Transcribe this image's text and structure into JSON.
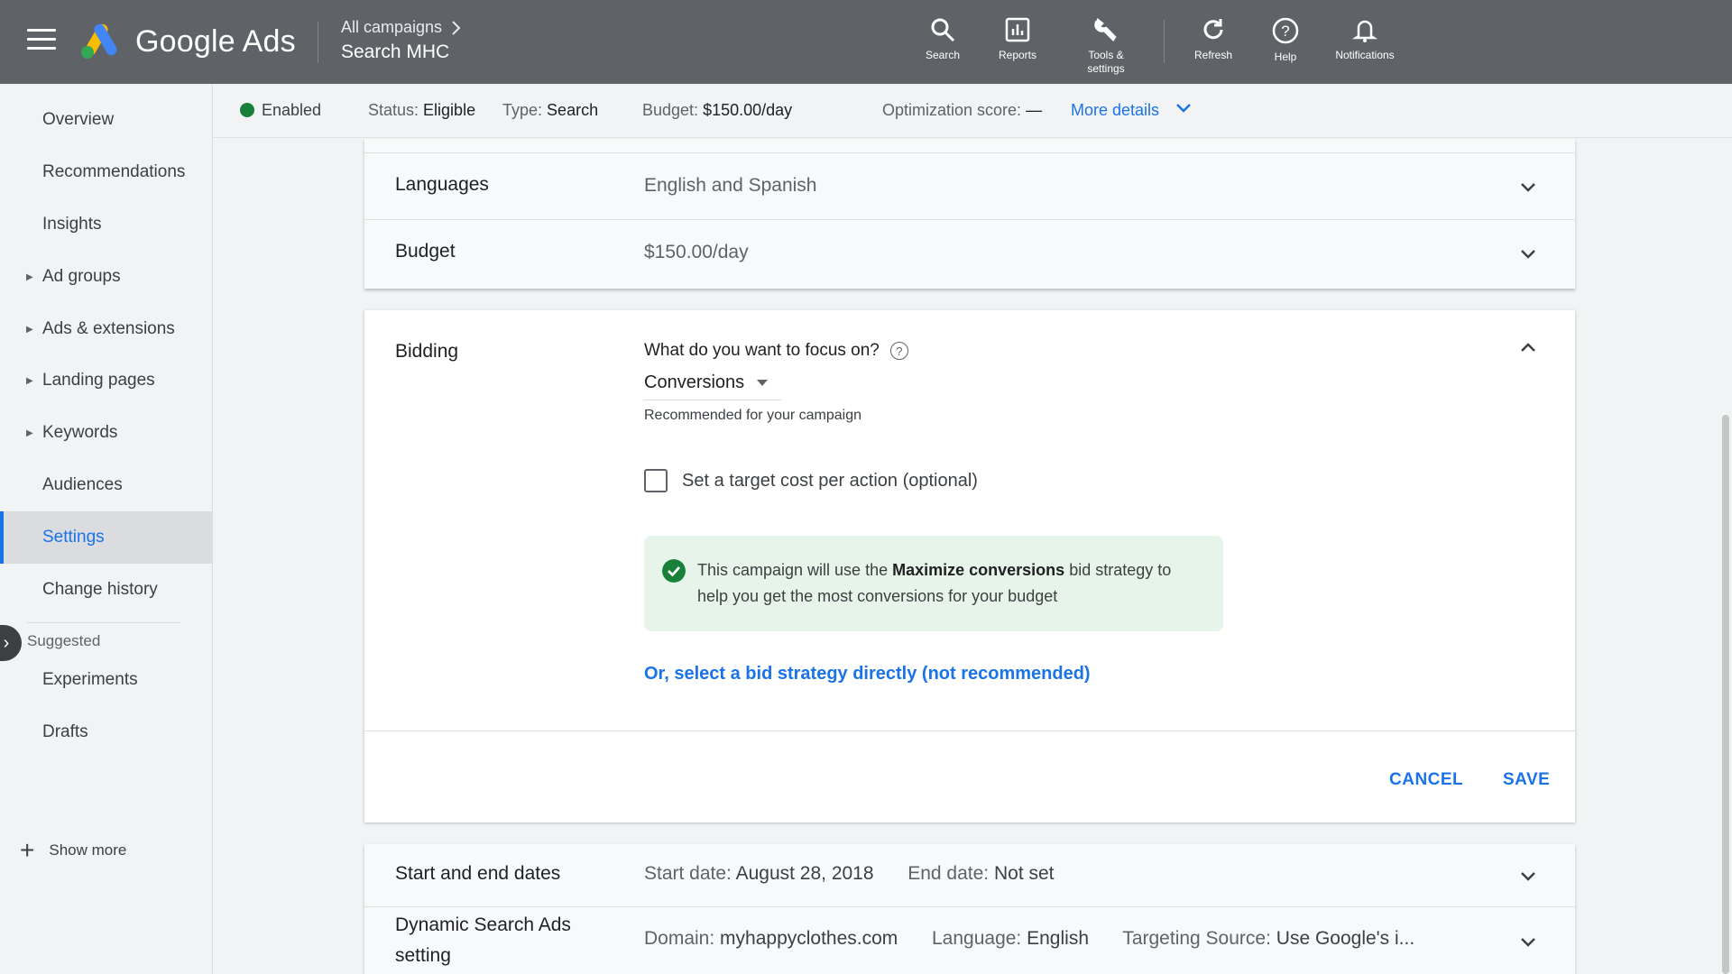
{
  "header": {
    "brand": "Google Ads",
    "breadcrumb": "All campaigns",
    "campaign_name": "Search MHC",
    "tools": [
      {
        "label": "Search",
        "icon": "search-icon"
      },
      {
        "label": "Reports",
        "icon": "reports-icon"
      },
      {
        "label": "Tools &\nsettings",
        "icon": "wrench-icon"
      },
      {
        "label": "Refresh",
        "icon": "refresh-icon"
      },
      {
        "label": "Help",
        "icon": "help-icon"
      },
      {
        "label": "Notifications",
        "icon": "bell-icon"
      }
    ]
  },
  "sidebar": {
    "items": [
      {
        "label": "Overview"
      },
      {
        "label": "Recommendations"
      },
      {
        "label": "Insights"
      },
      {
        "label": "Ad groups"
      },
      {
        "label": "Ads & extensions"
      },
      {
        "label": "Landing pages"
      },
      {
        "label": "Keywords"
      },
      {
        "label": "Audiences"
      },
      {
        "label": "Settings"
      },
      {
        "label": "Change history"
      }
    ],
    "suggested_label": "Suggested",
    "suggested_items": [
      {
        "label": "Experiments"
      },
      {
        "label": "Drafts"
      }
    ],
    "show_more": "Show more"
  },
  "status_bar": {
    "state": "Enabled",
    "status_label": "Status:",
    "status_value": "Eligible",
    "type_label": "Type:",
    "type_value": "Search",
    "budget_label": "Budget:",
    "budget_value": "$150.00/day",
    "opt_label": "Optimization score:",
    "opt_value": "—",
    "more_details": "More details"
  },
  "settings": {
    "languages": {
      "label": "Languages",
      "value": "English and Spanish"
    },
    "budget": {
      "label": "Budget",
      "value": "$150.00/day"
    },
    "bidding": {
      "label": "Bidding",
      "question": "What do you want to focus on?",
      "focus_value": "Conversions",
      "recommended_note": "Recommended for your campaign",
      "cpa_checkbox_label": "Set a target cost per action (optional)",
      "info_prefix": "This campaign will use the ",
      "info_bold": "Maximize conversions",
      "info_suffix": " bid strategy to help you get the most conversions for your budget",
      "select_link": "Or, select a bid strategy directly (not recommended)",
      "cancel": "CANCEL",
      "save": "SAVE"
    },
    "dates": {
      "label": "Start and end dates",
      "start_label": "Start date:",
      "start_value": "August 28, 2018",
      "end_label": "End date:",
      "end_value": "Not set"
    },
    "dsa": {
      "label_line1": "Dynamic Search Ads",
      "label_line2": "setting",
      "domain_label": "Domain:",
      "domain_value": "myhappyclothes.com",
      "language_label": "Language:",
      "language_value": "English",
      "source_label": "Targeting Source:",
      "source_value": "Use Google's i..."
    }
  },
  "colors": {
    "accent": "#1a73e8",
    "topbar": "#5f6368",
    "success": "#188038",
    "info_bg": "#e6f4ea"
  }
}
